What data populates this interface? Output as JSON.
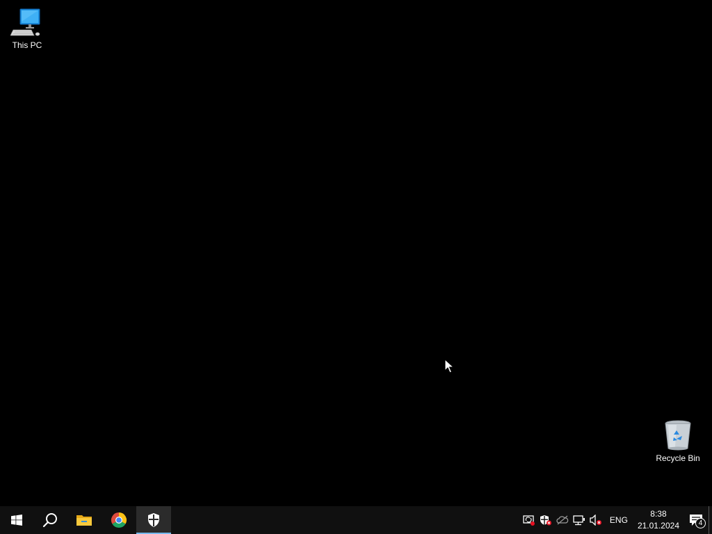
{
  "desktop": {
    "background_color": "#000000",
    "icons": [
      {
        "label": "This PC",
        "icon": "this-pc-icon"
      },
      {
        "label": "Recycle Bin",
        "icon": "recycle-bin-icon"
      }
    ]
  },
  "taskbar": {
    "background_color": "#101010",
    "accent_color": "#76b9ed",
    "buttons": [
      {
        "icon": "windows-start-icon"
      },
      {
        "icon": "search-icon"
      },
      {
        "icon": "file-explorer-icon"
      },
      {
        "icon": "chrome-icon"
      },
      {
        "icon": "windows-security-icon",
        "active": true
      }
    ],
    "tray": {
      "icons": [
        "remote-assist-icon",
        "security-alert-icon",
        "onedrive-icon",
        "network-icon",
        "volume-muted-icon"
      ],
      "language": "ENG",
      "time": "8:38",
      "date": "21.01.2024",
      "notification_count": "4"
    }
  }
}
